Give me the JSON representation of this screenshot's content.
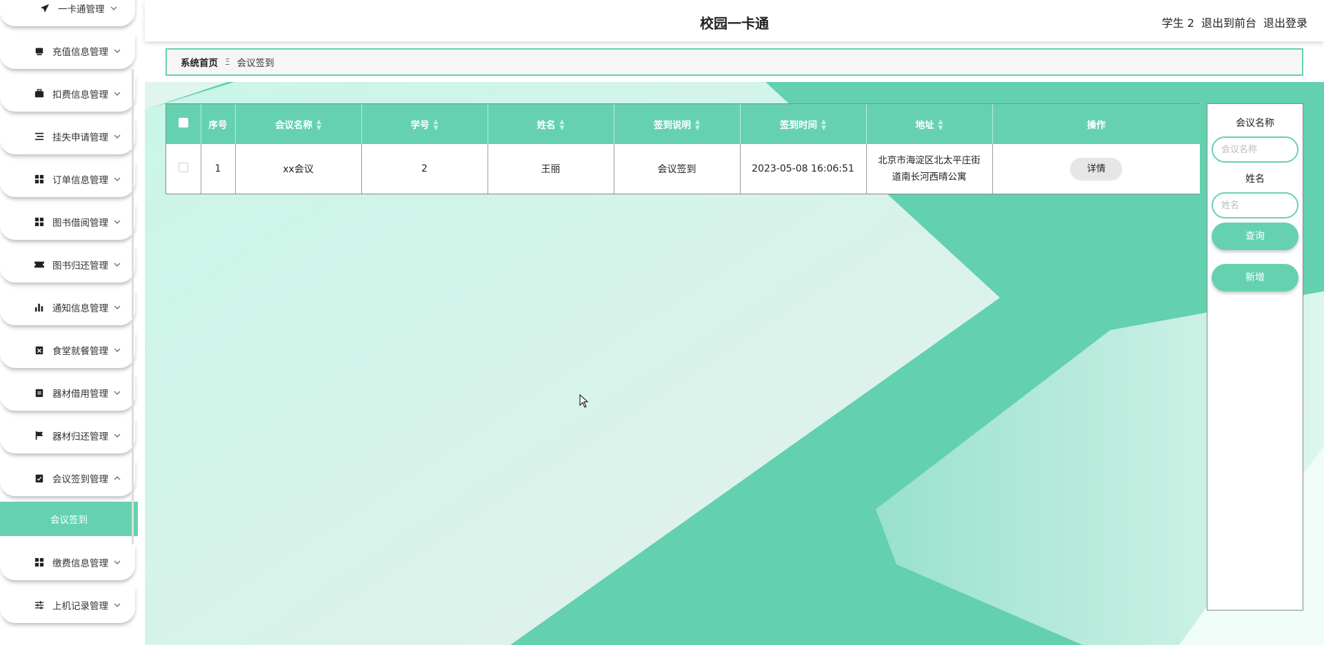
{
  "header": {
    "title": "校园一卡通",
    "user": "学生 2",
    "exit_front": "退出到前台",
    "logout": "退出登录"
  },
  "breadcrumb": {
    "home": "系统首页",
    "separator": "Ξ",
    "current": "会议签到"
  },
  "sidebar": {
    "items": [
      {
        "label": "一卡通管理",
        "icon": "send-icon"
      },
      {
        "label": "充值信息管理",
        "icon": "cart-icon"
      },
      {
        "label": "扣费信息管理",
        "icon": "briefcase-icon"
      },
      {
        "label": "挂失申请管理",
        "icon": "list-icon"
      },
      {
        "label": "订单信息管理",
        "icon": "grid-icon"
      },
      {
        "label": "图书借阅管理",
        "icon": "grid-icon"
      },
      {
        "label": "图书归还管理",
        "icon": "ticket-icon"
      },
      {
        "label": "通知信息管理",
        "icon": "bar-chart-icon"
      },
      {
        "label": "食堂就餐管理",
        "icon": "clipboard-x-icon"
      },
      {
        "label": "器材借用管理",
        "icon": "clipboard-icon"
      },
      {
        "label": "器材归还管理",
        "icon": "flag-icon"
      },
      {
        "label": "会议签到管理",
        "icon": "clipboard-check-icon"
      },
      {
        "label": "缴费信息管理",
        "icon": "grid-icon"
      },
      {
        "label": "上机记录管理",
        "icon": "sliders-icon"
      }
    ],
    "active_submenu": "会议签到"
  },
  "table": {
    "columns": [
      "序号",
      "会议名称",
      "学号",
      "姓名",
      "签到说明",
      "签到时间",
      "地址",
      "操作"
    ],
    "rows": [
      {
        "index": "1",
        "meeting_name": "xx会议",
        "student_no": "2",
        "name": "王丽",
        "checkin_desc": "会议签到",
        "checkin_time": "2023-05-08 16:06:51",
        "address_line1": "北京市海淀区北太平庄街",
        "address_line2": "道南长河西晴公寓",
        "action": "详情"
      }
    ]
  },
  "search": {
    "meeting_label": "会议名称",
    "meeting_placeholder": "会议名称",
    "name_label": "姓名",
    "name_placeholder": "姓名",
    "query_button": "查询",
    "add_button": "新增"
  },
  "colors": {
    "accent": "#66d1b0",
    "background_light": "#d4f7ec"
  }
}
